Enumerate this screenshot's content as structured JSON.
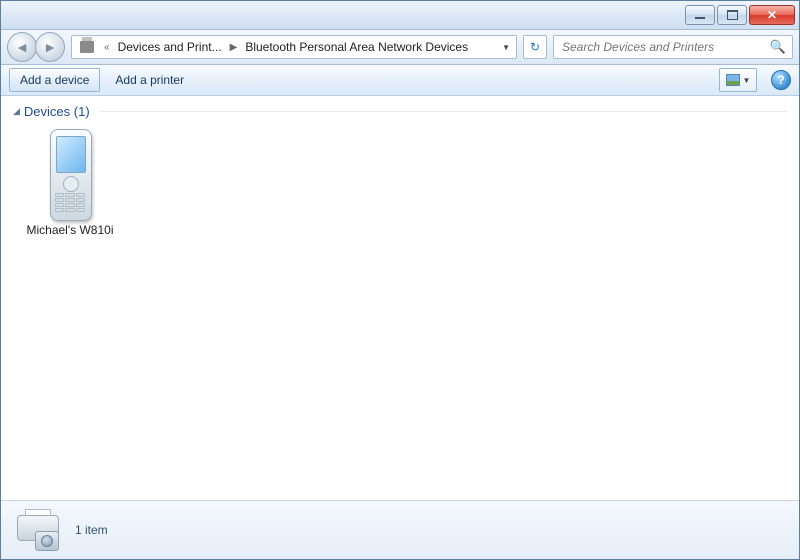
{
  "breadcrumb": {
    "segment1": "Devices and Print...",
    "segment2": "Bluetooth Personal Area Network Devices",
    "leading_chevrons": "«"
  },
  "search": {
    "placeholder": "Search Devices and Printers"
  },
  "toolbar": {
    "add_device_label": "Add a device",
    "add_printer_label": "Add a printer"
  },
  "group": {
    "header": "Devices (1)"
  },
  "devices": [
    {
      "name": "Michael's W810i"
    }
  ],
  "status": {
    "text": "1 item"
  },
  "help": {
    "glyph": "?"
  },
  "colors": {
    "accent": "#1e4e8c",
    "chrome_border": "#a8bdd4"
  }
}
